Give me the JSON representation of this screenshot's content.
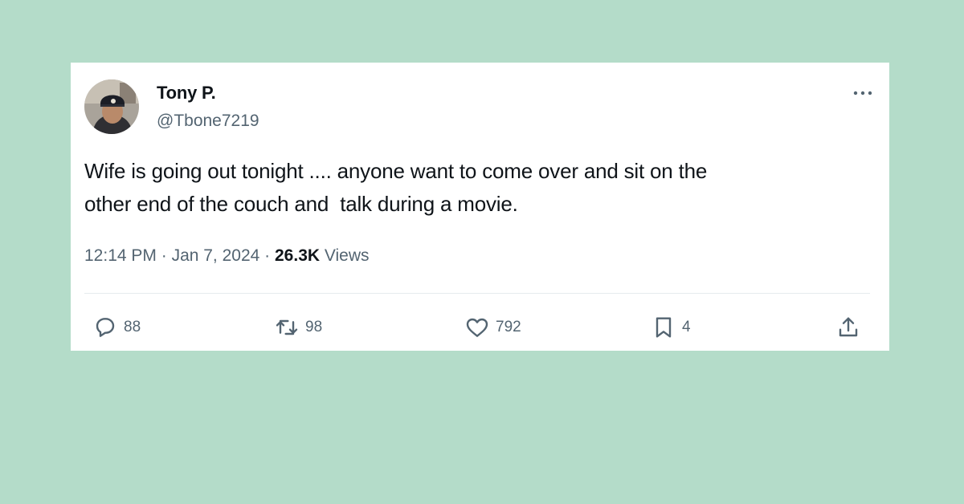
{
  "tweet": {
    "author": {
      "display_name": "Tony P.",
      "handle": "@Tbone7219"
    },
    "text": "Wife is going out tonight .... anyone want to come over and sit on the\nother end of the couch and  talk during a movie.",
    "time": "12:14 PM",
    "separator": " · ",
    "date": "Jan 7, 2024",
    "views_count": "26.3K",
    "views_label": " Views"
  },
  "actions": {
    "replies": "88",
    "retweets": "98",
    "likes": "792",
    "bookmarks": "4"
  },
  "icons": {
    "more": "more-horizontal-icon",
    "reply": "reply-bubble-icon",
    "retweet": "retweet-icon",
    "like": "heart-icon",
    "bookmark": "bookmark-icon",
    "share": "share-upload-icon"
  },
  "colors": {
    "background": "#b4dcc9",
    "card": "#ffffff",
    "text_primary": "#0f1419",
    "text_secondary": "#536471"
  }
}
